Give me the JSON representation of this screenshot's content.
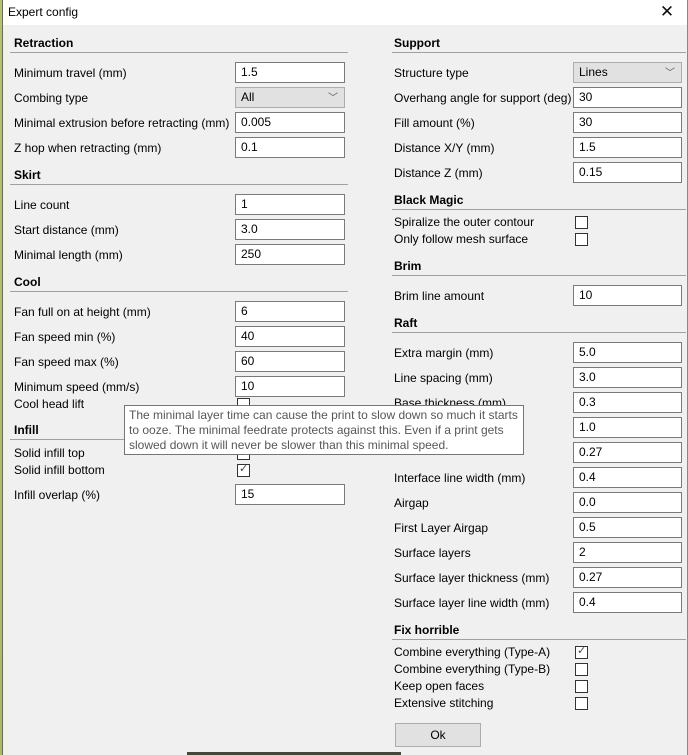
{
  "window": {
    "title": "Expert config",
    "close_icon": "close-icon"
  },
  "left": {
    "retraction": {
      "title": "Retraction",
      "rows": [
        {
          "label": "Minimum travel (mm)",
          "type": "text",
          "value": "1.5"
        },
        {
          "label": "Combing type",
          "type": "select",
          "value": "All"
        },
        {
          "label": "Minimal extrusion before retracting (mm)",
          "type": "text",
          "value": "0.005"
        },
        {
          "label": "Z hop when retracting (mm)",
          "type": "text",
          "value": "0.1"
        }
      ]
    },
    "skirt": {
      "title": "Skirt",
      "rows": [
        {
          "label": "Line count",
          "type": "text",
          "value": "1"
        },
        {
          "label": "Start distance (mm)",
          "type": "text",
          "value": "3.0"
        },
        {
          "label": "Minimal length (mm)",
          "type": "text",
          "value": "250"
        }
      ]
    },
    "cool": {
      "title": "Cool",
      "rows": [
        {
          "label": "Fan full on at height (mm)",
          "type": "text",
          "value": "6"
        },
        {
          "label": "Fan speed min (%)",
          "type": "text",
          "value": "40"
        },
        {
          "label": "Fan speed max (%)",
          "type": "text",
          "value": "60"
        },
        {
          "label": "Minimum speed (mm/s)",
          "type": "text",
          "value": "10"
        },
        {
          "label": "Cool head lift",
          "type": "checkbox",
          "checked": false
        }
      ]
    },
    "infill": {
      "title": "Infill",
      "rows": [
        {
          "label": "Solid infill top",
          "type": "checkbox",
          "checked": true
        },
        {
          "label": "Solid infill bottom",
          "type": "checkbox",
          "checked": true
        },
        {
          "label": "Infill overlap (%)",
          "type": "text",
          "value": "15"
        }
      ]
    }
  },
  "right": {
    "support": {
      "title": "Support",
      "rows": [
        {
          "label": "Structure type",
          "type": "select",
          "value": "Lines"
        },
        {
          "label": "Overhang angle for support (deg)",
          "type": "text",
          "value": "30"
        },
        {
          "label": "Fill amount (%)",
          "type": "text",
          "value": "30"
        },
        {
          "label": "Distance X/Y (mm)",
          "type": "text",
          "value": "1.5"
        },
        {
          "label": "Distance Z (mm)",
          "type": "text",
          "value": "0.15"
        }
      ]
    },
    "black_magic": {
      "title": "Black Magic",
      "rows": [
        {
          "label": "Spiralize the outer contour",
          "type": "checkbox",
          "checked": false
        },
        {
          "label": "Only follow mesh surface",
          "type": "checkbox",
          "checked": false
        }
      ]
    },
    "brim": {
      "title": "Brim",
      "rows": [
        {
          "label": "Brim line amount",
          "type": "text",
          "value": "10"
        }
      ]
    },
    "raft": {
      "title": "Raft",
      "rows": [
        {
          "label": "Extra margin (mm)",
          "type": "text",
          "value": "5.0"
        },
        {
          "label": "Line spacing (mm)",
          "type": "text",
          "value": "3.0"
        },
        {
          "label": "Base thickness (mm)",
          "type": "text",
          "value": "0.3"
        },
        {
          "label": "",
          "type": "text",
          "value": "1.0"
        },
        {
          "label": "",
          "type": "text",
          "value": "0.27"
        },
        {
          "label": "Interface line width (mm)",
          "type": "text",
          "value": "0.4"
        },
        {
          "label": "Airgap",
          "type": "text",
          "value": "0.0"
        },
        {
          "label": "First Layer Airgap",
          "type": "text",
          "value": "0.5"
        },
        {
          "label": "Surface layers",
          "type": "text",
          "value": "2"
        },
        {
          "label": "Surface layer thickness (mm)",
          "type": "text",
          "value": "0.27"
        },
        {
          "label": "Surface layer line width (mm)",
          "type": "text",
          "value": "0.4"
        }
      ]
    },
    "fix_horrible": {
      "title": "Fix horrible",
      "rows": [
        {
          "label": "Combine everything (Type-A)",
          "type": "checkbox",
          "checked": true
        },
        {
          "label": "Combine everything (Type-B)",
          "type": "checkbox",
          "checked": false
        },
        {
          "label": "Keep open faces",
          "type": "checkbox",
          "checked": false
        },
        {
          "label": "Extensive stitching",
          "type": "checkbox",
          "checked": false
        }
      ]
    }
  },
  "tooltip": "The minimal layer time can cause the print to slow down so much it starts to ooze. The minimal feedrate protects against this. Even if a print gets slowed down it will never be slower than this minimal speed.",
  "ok_label": "Ok",
  "icons": {
    "checkmark": "✓",
    "chevron": "﹀",
    "close": "✕"
  }
}
